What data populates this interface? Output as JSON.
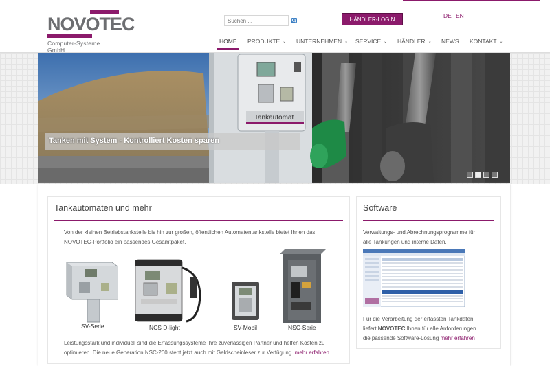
{
  "brand": {
    "logo_text": "NOVOTEC",
    "logo_sub": "Computer-Systeme GmbH",
    "color": "#8b1a6b"
  },
  "search": {
    "placeholder": "Suchen ...",
    "icon": "search-icon"
  },
  "login": {
    "label": "HÄNDLER-LOGIN"
  },
  "lang": {
    "de": "DE",
    "en": "EN"
  },
  "nav": {
    "items": [
      {
        "label": "HOME",
        "active": true
      },
      {
        "label": "PRODUKTE",
        "dropdown": true
      },
      {
        "label": "UNTERNEHMEN",
        "dropdown": true
      },
      {
        "label": "SERVICE",
        "dropdown": true
      },
      {
        "label": "HÄNDLER",
        "dropdown": true
      },
      {
        "label": "NEWS"
      },
      {
        "label": "KONTAKT",
        "dropdown": true
      }
    ],
    "caret": "⌄"
  },
  "hero": {
    "caption": "Tanken mit System - Kontrolliert Kosten sparen",
    "terminal_label": "Tankautomat",
    "slide_count": 4,
    "active_slide": 2
  },
  "main_panel": {
    "title": "Tankautomaten und mehr",
    "intro_1": "Von der kleinen Betriebstankstelle bis hin zur großen, öffentlichen Automatentankstelle bietet Ihnen das",
    "intro_2": "NOVOTEC-Portfolio ein passendes Gesamtpaket.",
    "products": [
      {
        "label": "SV-Serie"
      },
      {
        "label": "NCS D-light"
      },
      {
        "label": "SV-Mobil"
      },
      {
        "label": "NSC-Serie"
      }
    ],
    "outro_1": "Leistungsstark und individuell sind die Erfassungssysteme Ihre zuverlässigen Partner und helfen Kosten zu",
    "outro_2": "optimieren. Die neue Generation NSC-200 steht jetzt auch mit Geldscheinleser zur Verfügung.",
    "more": "mehr erfahren"
  },
  "software_panel": {
    "title": "Software",
    "intro_1": "Verwaltungs- und Abrechnungsprogramme für",
    "intro_2": "alle Tankungen und interne Daten.",
    "outro_1": "Für die Verarbeitung der erfassten Tankdaten",
    "outro_2a": "liefert ",
    "outro_2b": "NOVOTEC",
    "outro_2c": " Ihnen für alle Anforderungen",
    "outro_3": "die passende Software-Lösung ",
    "more": "mehr erfahren"
  }
}
